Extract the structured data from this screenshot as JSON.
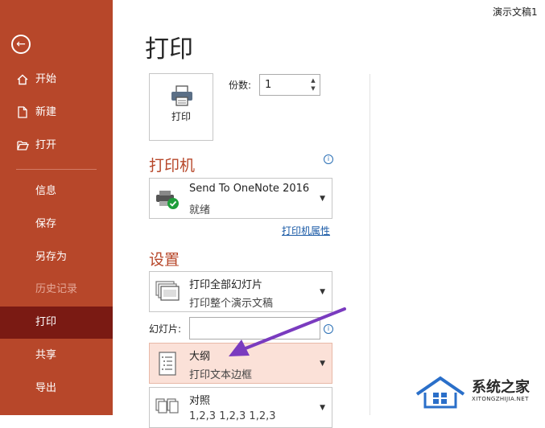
{
  "window": {
    "doc_title": "演示文稿1"
  },
  "sidebar": {
    "items": [
      {
        "label": "开始",
        "icon": "home-icon"
      },
      {
        "label": "新建",
        "icon": "new-file-icon"
      },
      {
        "label": "打开",
        "icon": "open-folder-icon"
      },
      {
        "label": "信息"
      },
      {
        "label": "保存"
      },
      {
        "label": "另存为"
      },
      {
        "label": "历史记录",
        "disabled": true
      },
      {
        "label": "打印",
        "active": true
      },
      {
        "label": "共享"
      },
      {
        "label": "导出"
      }
    ],
    "accent": "#b7472a",
    "active_bg": "#7a1a13"
  },
  "main": {
    "title": "打印",
    "print_button_label": "打印",
    "copies": {
      "label": "份数:",
      "value": "1"
    },
    "printer": {
      "heading": "打印机",
      "name": "Send To OneNote 2016",
      "status": "就绪",
      "properties_link": "打印机属性"
    },
    "settings": {
      "heading": "设置",
      "range": {
        "title": "打印全部幻灯片",
        "subtitle": "打印整个演示文稿"
      },
      "slides_label": "幻灯片:",
      "slides_value": "",
      "layout": {
        "title": "大纲",
        "subtitle": "打印文本边框"
      },
      "collate": {
        "title": "对照",
        "subtitle": "1,2,3    1,2,3    1,2,3"
      }
    }
  },
  "annotation": {
    "arrow_color": "#7a3bbf"
  },
  "watermark": {
    "name": "系统之家",
    "url": "XITONGZHIJIA.NET"
  }
}
